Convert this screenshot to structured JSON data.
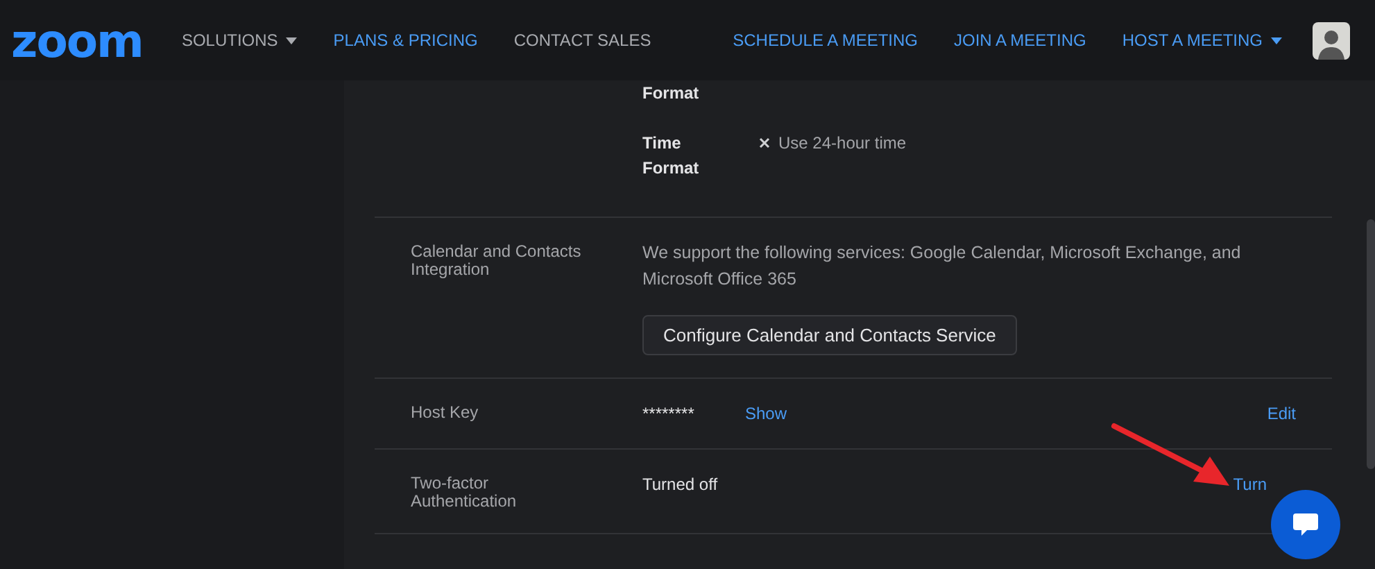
{
  "nav": {
    "logo": "zoom",
    "left": [
      {
        "label": "SOLUTIONS",
        "dropdown": true,
        "highlight": false
      },
      {
        "label": "PLANS & PRICING",
        "dropdown": false,
        "highlight": true
      },
      {
        "label": "CONTACT SALES",
        "dropdown": false,
        "highlight": false
      }
    ],
    "right": [
      {
        "label": "SCHEDULE A MEETING",
        "dropdown": false
      },
      {
        "label": "JOIN A MEETING",
        "dropdown": false
      },
      {
        "label": "HOST A MEETING",
        "dropdown": true
      }
    ]
  },
  "format_rows": [
    {
      "label": "Format",
      "option": ""
    },
    {
      "label": "Time Format",
      "checked": false,
      "option": "Use 24-hour time"
    }
  ],
  "settings": [
    {
      "kind": "service",
      "label": "Calendar and Contacts Integration",
      "text": "We support the following services: Google Calendar, Microsoft Exchange, and Microsoft Office 365",
      "button": "Configure Calendar and Contacts Service"
    },
    {
      "kind": "key",
      "label": "Host Key",
      "value": "********",
      "link": "Show",
      "action": "Edit"
    },
    {
      "kind": "status",
      "label": "Two-factor Authentication",
      "value": "Turned off",
      "action": "Turn"
    }
  ]
}
